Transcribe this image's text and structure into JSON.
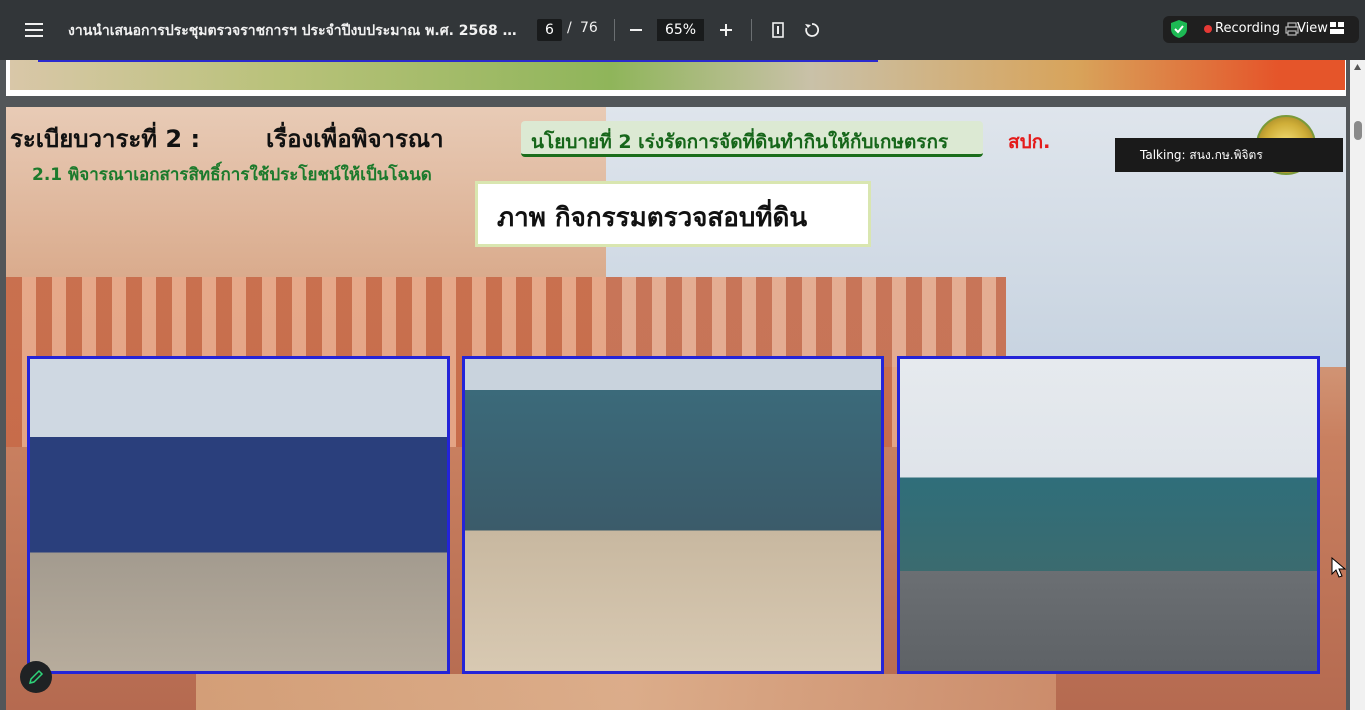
{
  "toolbar": {
    "title": "งานนำเสนอการประชุมตรวจราชการฯ ประจำปีงบประมาณ พ.ศ. 2568 รอ...",
    "page_current": "6",
    "page_separator": "/",
    "page_total": "76",
    "zoom": "65%",
    "recording_label": "Recording",
    "view_label": "View"
  },
  "slide": {
    "heading": "ระเบียบวาระที่ 2 :",
    "topic": "เรื่องเพื่อพิจารณา",
    "policy": "นโยบายที่ 2 เร่งรัดการจัดที่ดินทำกินให้กับเกษตรกร",
    "agency": "สปก.",
    "sub_heading": "2.1 พิจารณาเอกสารสิทธิ์การใช้ประโยชน์ให้เป็นโฉนด",
    "caption": "ภาพ กิจกรรมตรวจสอบที่ดิน"
  },
  "overlay": {
    "talking": "Talking: สนง.กษ.พิจิตร"
  },
  "colors": {
    "toolbar_bg": "#323639",
    "viewer_bg": "#525659",
    "photo_border": "#2424d8",
    "policy_text": "#16661a",
    "agency_text": "#e41b1b",
    "sub_heading_text": "#1c7a2c",
    "recording_dot": "#e53935"
  },
  "icons": [
    "menu-icon",
    "zoom-out-icon",
    "zoom-in-icon",
    "fit-page-icon",
    "rotate-icon",
    "shield-check-icon",
    "printer-icon",
    "grid-icon",
    "pencil-icon",
    "scroll-up-icon",
    "mouse-cursor-icon"
  ]
}
